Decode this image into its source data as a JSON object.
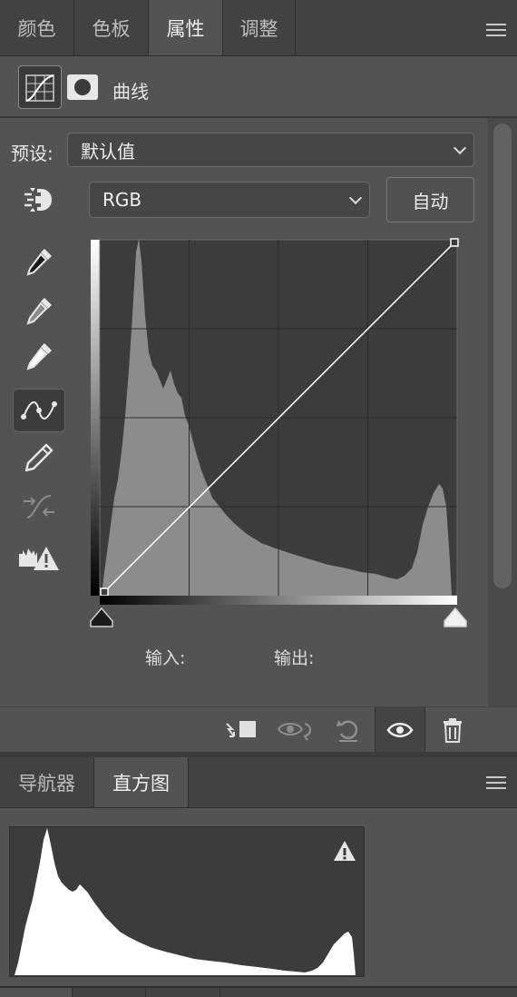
{
  "top_tabs": [
    {
      "label": "颜色",
      "active": false
    },
    {
      "label": "色板",
      "active": false
    },
    {
      "label": "属性",
      "active": true
    },
    {
      "label": "调整",
      "active": false
    }
  ],
  "properties": {
    "title": "曲线",
    "preset_label": "预设:",
    "preset_value": "默认值",
    "channel_value": "RGB",
    "auto_button": "自动",
    "input_label": "输入:",
    "output_label": "输出:"
  },
  "tools": [
    {
      "icon": "target-adjust-icon",
      "active": false
    },
    {
      "icon": "black-point-eyedropper-icon",
      "active": false
    },
    {
      "icon": "gray-point-eyedropper-icon",
      "active": false
    },
    {
      "icon": "white-point-eyedropper-icon",
      "active": false
    },
    {
      "icon": "curve-points-icon",
      "active": true
    },
    {
      "icon": "pencil-icon",
      "active": false
    },
    {
      "icon": "smooth-curve-icon",
      "active": false
    },
    {
      "icon": "clipping-warning-icon",
      "active": false
    }
  ],
  "bottom_actions": [
    "clip-to-layer-icon",
    "view-previous-state-icon",
    "reset-icon",
    "visibility-eye-icon",
    "delete-icon"
  ],
  "bottom_tabs": [
    {
      "label": "导航器",
      "active": false
    },
    {
      "label": "直方图",
      "active": true
    }
  ],
  "colors": {
    "panel_bg": "#535353",
    "tab_bg": "#424242",
    "graph_bg": "#3c3c3c",
    "histogram_fill": "#8c8c8c"
  }
}
